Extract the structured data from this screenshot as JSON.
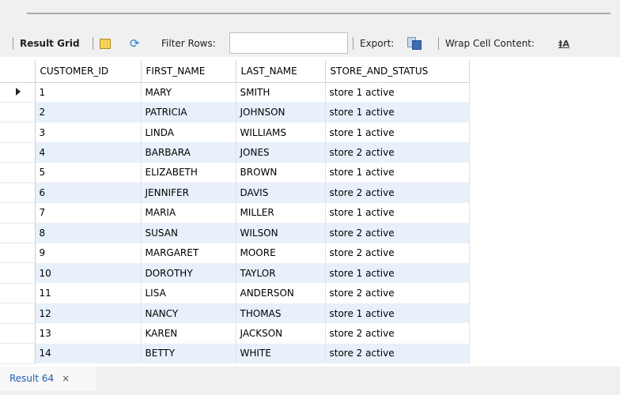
{
  "toolbar": {
    "result_grid_label": "Result Grid",
    "filter_rows_label": "Filter Rows:",
    "filter_value": "",
    "export_label": "Export:",
    "wrap_label": "Wrap Cell Content:",
    "icons": [
      "grid-layout-icon",
      "refresh-icon",
      "export-icon",
      "wrap-cell-icon"
    ]
  },
  "grid": {
    "columns": [
      "CUSTOMER_ID",
      "FIRST_NAME",
      "LAST_NAME",
      "STORE_AND_STATUS"
    ],
    "rows": [
      [
        "1",
        "MARY",
        "SMITH",
        "store 1 active"
      ],
      [
        "2",
        "PATRICIA",
        "JOHNSON",
        "store 1 active"
      ],
      [
        "3",
        "LINDA",
        "WILLIAMS",
        "store 1 active"
      ],
      [
        "4",
        "BARBARA",
        "JONES",
        "store 2 active"
      ],
      [
        "5",
        "ELIZABETH",
        "BROWN",
        "store 1 active"
      ],
      [
        "6",
        "JENNIFER",
        "DAVIS",
        "store 2 active"
      ],
      [
        "7",
        "MARIA",
        "MILLER",
        "store 1 active"
      ],
      [
        "8",
        "SUSAN",
        "WILSON",
        "store 2 active"
      ],
      [
        "9",
        "MARGARET",
        "MOORE",
        "store 2 active"
      ],
      [
        "10",
        "DOROTHY",
        "TAYLOR",
        "store 1 active"
      ],
      [
        "11",
        "LISA",
        "ANDERSON",
        "store 2 active"
      ],
      [
        "12",
        "NANCY",
        "THOMAS",
        "store 1 active"
      ],
      [
        "13",
        "KAREN",
        "JACKSON",
        "store 2 active"
      ],
      [
        "14",
        "BETTY",
        "WHITE",
        "store 2 active"
      ]
    ],
    "colors": {
      "even_row": "#e8f1fb",
      "odd_row": "#ffffff",
      "tab_text": "#1f5fae"
    }
  },
  "bottom_tabs": {
    "result_tab_label": "Result 64",
    "close_glyph": "×"
  }
}
